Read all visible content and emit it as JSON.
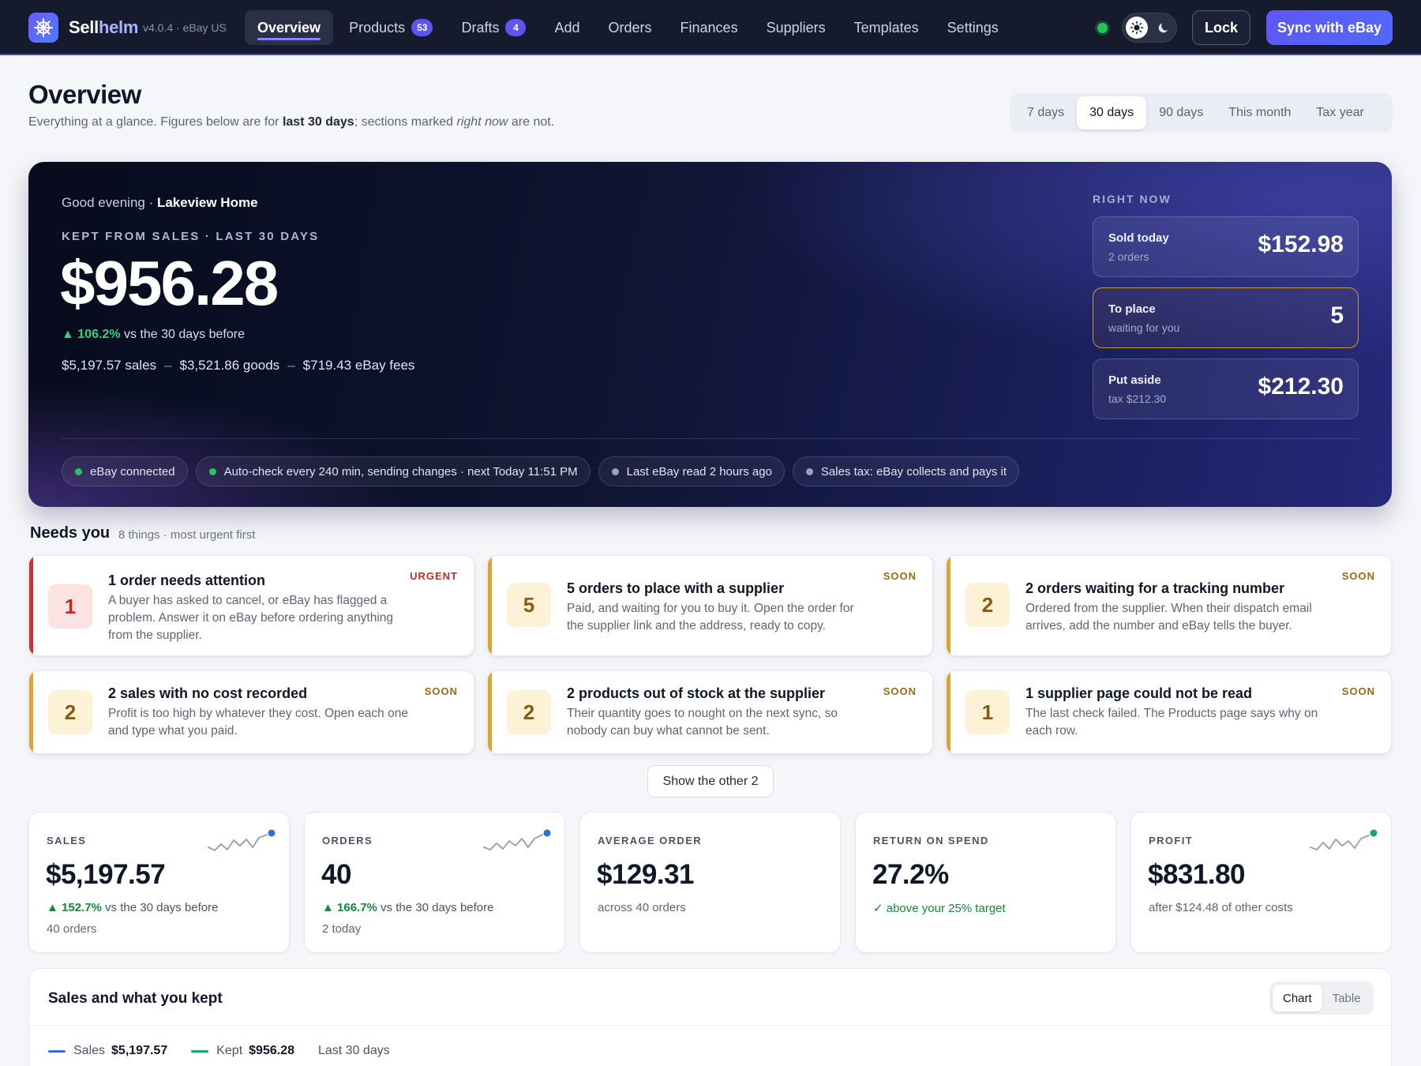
{
  "app": {
    "name_a": "Sell",
    "name_b": "helm",
    "version": "v4.0.4 · eBay US",
    "tabs": [
      {
        "label": "Overview",
        "badge": null
      },
      {
        "label": "Products",
        "badge": "53"
      },
      {
        "label": "Drafts",
        "badge": "4"
      },
      {
        "label": "Add",
        "badge": null
      },
      {
        "label": "Orders",
        "badge": null
      },
      {
        "label": "Finances",
        "badge": null
      },
      {
        "label": "Suppliers",
        "badge": null
      },
      {
        "label": "Templates",
        "badge": null
      },
      {
        "label": "Settings",
        "badge": null
      }
    ],
    "lock_label": "Lock",
    "sync_label": "Sync with eBay",
    "icons": {
      "logo": "ship-wheel-icon",
      "light": "sun-icon",
      "dark": "moon-icon"
    },
    "colors": {
      "accent": "#5f56f6",
      "nav_bg": "#151b2d",
      "ok": "#22c55e",
      "urgent": "#d32f2f",
      "soon": "#e0a232"
    }
  },
  "header": {
    "title": "Overview",
    "subtitle_a": "Everything at a glance. Figures below are for ",
    "subtitle_b": "last 30 days",
    "subtitle_c": "; sections marked ",
    "subtitle_d": "right now",
    "subtitle_e": " are not.",
    "ranges": [
      "7 days",
      "30 days",
      "90 days",
      "This month",
      "Tax year"
    ],
    "active_range": "30 days"
  },
  "hero": {
    "greeting": "Good evening · ",
    "shop": "Lakeview Home",
    "kept_label": "KEPT FROM SALES · LAST 30 DAYS",
    "kept_value": "$956.28",
    "change_value": "▲ 106.2%",
    "change_text": " vs the 30 days before",
    "sales": "$5,197.57 sales",
    "goods": "$3,521.86 goods",
    "fees": "$719.43 eBay fees",
    "sep": "–",
    "right_now_label": "RIGHT NOW",
    "right_now": [
      {
        "title": "Sold today",
        "sub": "2 orders",
        "value": "$152.98"
      },
      {
        "title": "To place",
        "sub": "waiting for you",
        "value": "5"
      },
      {
        "title": "Put aside",
        "sub": "tax $212.30",
        "value": "$212.30"
      }
    ],
    "pills": [
      {
        "text": "eBay connected",
        "color": "#22c55e"
      },
      {
        "text": "Auto-check every 240 min, sending changes · next Today 11:51 PM",
        "color": "#22c55e"
      },
      {
        "text": "Last eBay read 2 hours ago",
        "color": "#94a3c8"
      },
      {
        "text": "Sales tax: eBay collects and pays it",
        "color": "#94a3c8"
      }
    ]
  },
  "needs": {
    "title": "Needs you",
    "meta": "8 things · most urgent first",
    "items": [
      {
        "count": "1",
        "title": "1 order needs attention",
        "body": "A buyer has asked to cancel, or eBay has flagged a problem. Answer it on eBay before ordering anything from the supplier.",
        "tag": "URGENT"
      },
      {
        "count": "5",
        "title": "5 orders to place with a supplier",
        "body": "Paid, and waiting for you to buy it. Open the order for the supplier link and the address, ready to copy.",
        "tag": "SOON"
      },
      {
        "count": "2",
        "title": "2 orders waiting for a tracking number",
        "body": "Ordered from the supplier. When their dispatch email arrives, add the number and eBay tells the buyer.",
        "tag": "SOON"
      },
      {
        "count": "2",
        "title": "2 sales with no cost recorded",
        "body": "Profit is too high by whatever they cost. Open each one and type what you paid.",
        "tag": "SOON"
      },
      {
        "count": "2",
        "title": "2 products out of stock at the supplier",
        "body": "Their quantity goes to nought on the next sync, so nobody can buy what cannot be sent.",
        "tag": "SOON"
      },
      {
        "count": "1",
        "title": "1 supplier page could not be read",
        "body": "The last check failed. The Products page says why on each row.",
        "tag": "SOON"
      }
    ],
    "show_more": "Show the other 2"
  },
  "stats": [
    {
      "label": "SALES",
      "value": "$5,197.57",
      "change": "▲ 152.7%",
      "change_text": " vs the 30 days before",
      "sub": "40 orders"
    },
    {
      "label": "ORDERS",
      "value": "40",
      "change": "▲ 166.7%",
      "change_text": " vs the 30 days before",
      "sub": "2 today"
    },
    {
      "label": "AVERAGE ORDER",
      "value": "$129.31",
      "note": "across 40 orders"
    },
    {
      "label": "RETURN ON SPEND",
      "value": "27.2%",
      "note": "✓ above your 25% target"
    },
    {
      "label": "PROFIT",
      "value": "$831.80",
      "note": "after $124.48 of other costs"
    }
  ],
  "chart_panel": {
    "title": "Sales and what you kept",
    "views": [
      "Chart",
      "Table"
    ],
    "active_view": "Chart",
    "legend": [
      {
        "name": "Sales",
        "value": "$5,197.57",
        "color": "#2f6fd6"
      },
      {
        "name": "Kept",
        "value": "$956.28",
        "color": "#1aa37a"
      }
    ],
    "period": "Last 30 days"
  }
}
